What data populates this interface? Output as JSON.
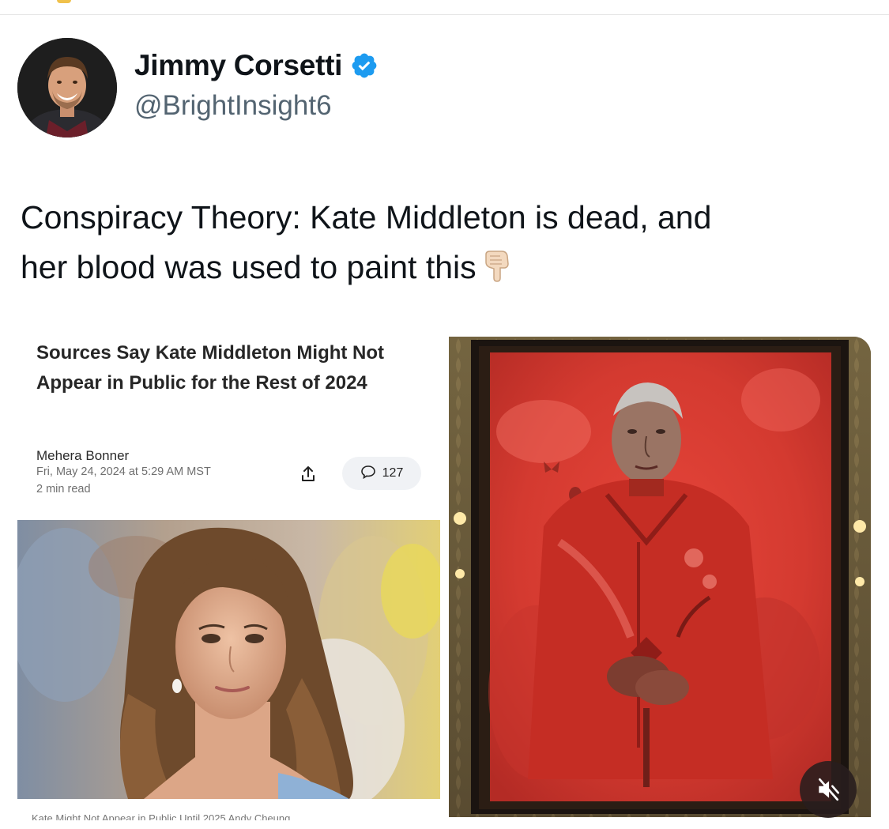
{
  "author": {
    "display_name": "Jimmy Corsetti",
    "handle": "@BrightInsight6",
    "verified": true,
    "avatar_icon": "profile-avatar"
  },
  "tweet": {
    "line1": "Conspiracy Theory: Kate Middleton is dead, and",
    "line2": "her blood was used to paint this",
    "emoji": "pointing-down-hand-icon"
  },
  "article": {
    "title": "Sources Say Kate Middleton Might Not Appear in Public for the Rest of 2024",
    "author": "Mehera Bonner",
    "date": "Fri, May 24, 2024 at 5:29 AM MST",
    "read_time": "2 min read",
    "comment_count": "127",
    "photo_caption": "Kate Might Not Appear in Public Until 2025 Andy Cheung"
  },
  "media": {
    "painting_icon": "red-portrait-painting",
    "mute_icon": "speaker-muted-icon"
  },
  "colors": {
    "verified_blue": "#1d9bf0",
    "handle_gray": "#536471",
    "text": "#0f1419",
    "painting_red": "#c8302a"
  }
}
